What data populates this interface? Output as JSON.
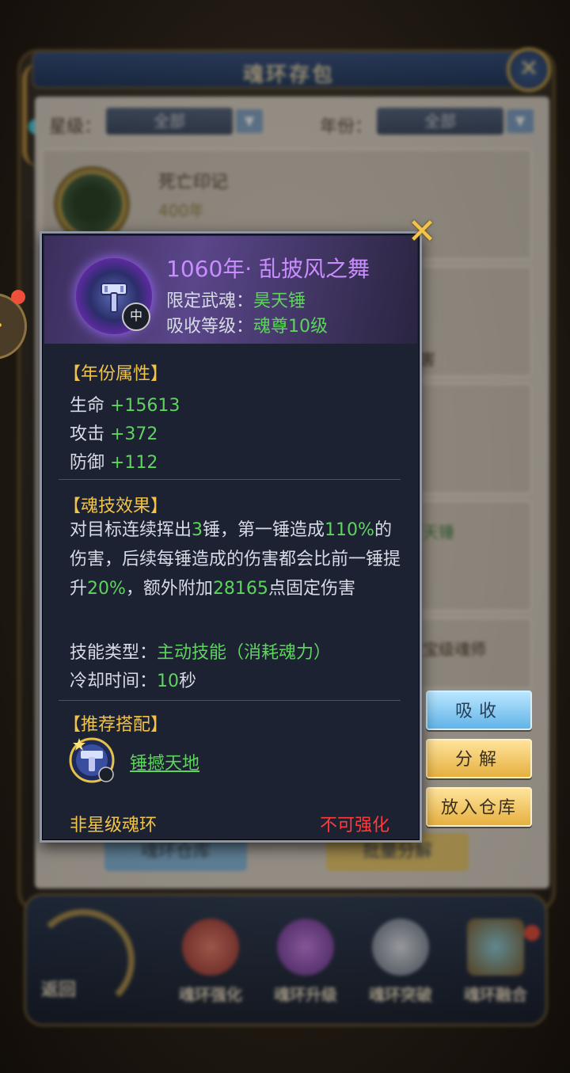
{
  "background": {
    "window_title": "魂环存包",
    "filters": [
      {
        "label": "星级：",
        "value": "全部"
      },
      {
        "label": "年份：",
        "value": "全部"
      }
    ],
    "cards": [
      {
        "name": "死亡印记",
        "year": "400年"
      }
    ],
    "card_fragments": [
      "害",
      "天锤",
      "宝级魂师"
    ],
    "bottom_buttons": [
      "魂环仓库",
      "批量分解"
    ],
    "back_label": "返回",
    "tray": [
      "魂环强化",
      "魂环升级",
      "魂环突破",
      "魂环融合"
    ]
  },
  "popup": {
    "title": "1060年· 乱披风之舞",
    "weapon_label": "限定武魂：",
    "weapon_value": "昊天锤",
    "absorb_label": "吸收等级：",
    "absorb_value": "魂尊10级",
    "icon_badge": "中",
    "year_section": "【年份属性】",
    "stats": [
      {
        "label": "生命 ",
        "value": "+15613"
      },
      {
        "label": "攻击 ",
        "value": "+372"
      },
      {
        "label": "防御 ",
        "value": "+112"
      }
    ],
    "skill_section": "【魂技效果】",
    "desc": {
      "p1": "对目标连续挥出",
      "n1": "3",
      "p2": "锤，第一锤造成",
      "n2": "110%",
      "p3": "的伤害，后续每锤造成的伤害都会比前一锤提升",
      "n3": "20%",
      "p4": "，额外附加",
      "n4": "28165",
      "p5": "点固定伤害"
    },
    "skill_type_label": "技能类型：",
    "skill_type_value": "主动技能（消耗魂力）",
    "cooldown_label": "冷却时间：",
    "cooldown_value": "10",
    "cooldown_unit": "秒",
    "recommend_section": "【推荐搭配】",
    "recommend_name": "锤撼天地",
    "footer_left": "非星级魂环",
    "footer_right": "不可强化"
  },
  "actions": {
    "absorb": "吸收",
    "decompose": "分解",
    "store": "放入仓库"
  },
  "colors": {
    "accent_green": "#5ed35e",
    "title_purple": "#c98dff",
    "section_gold": "#f0c34a",
    "warning_red": "#ff3b3b"
  }
}
